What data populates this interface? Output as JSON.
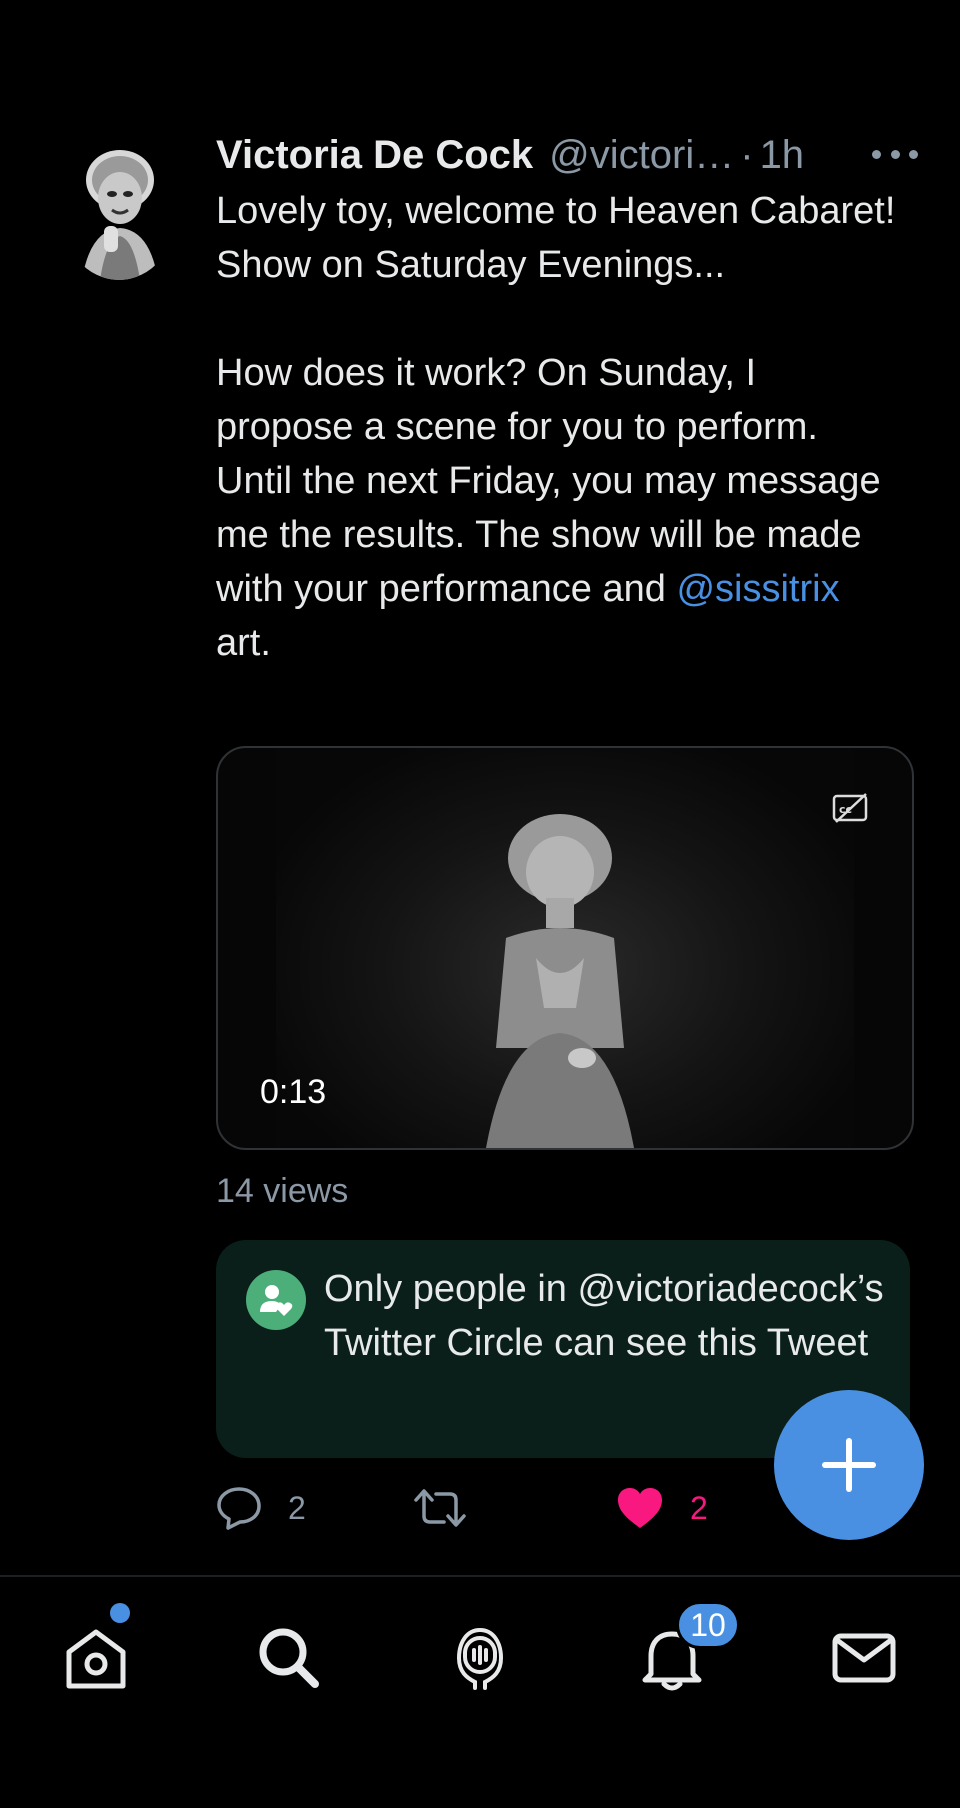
{
  "tweet": {
    "display_name": "Victoria De Cock",
    "handle": "@victori…",
    "separator": "·",
    "time": "1h",
    "text_para1": "Lovely toy, welcome to Heaven Cabaret! Show on Saturday Evenings...",
    "text_para2_before": "How does it work? On Sunday, I propose a scene for you to perform. Until the next Friday, you may message me the results. The show will be made with your performance and ",
    "text_mention": "@sissitrix",
    "text_para2_after": " art.",
    "video": {
      "duration": "0:13"
    },
    "views": "14 views",
    "circle_notice": "Only people in @victoriadecock’s Twitter Circle can see this Tweet",
    "actions": {
      "replies": "2",
      "retweets": "",
      "likes": "2"
    }
  },
  "tabbar": {
    "notification_count": "10"
  },
  "icons": {
    "more": "more-icon",
    "cc": "closed-captions-off-icon",
    "circle": "twitter-circle-icon",
    "reply": "reply-icon",
    "retweet": "retweet-icon",
    "like": "heart-icon",
    "compose": "plus-icon",
    "home": "home-icon",
    "search": "search-icon",
    "spaces": "spaces-icon",
    "notifications": "bell-icon",
    "messages": "mail-icon"
  },
  "colors": {
    "background": "#000000",
    "accent": "#4a90e2",
    "like": "#f91880",
    "circle_bg": "#0a1f1a",
    "circle_icon": "#4caf7a",
    "muted_text": "#8b98a5"
  }
}
